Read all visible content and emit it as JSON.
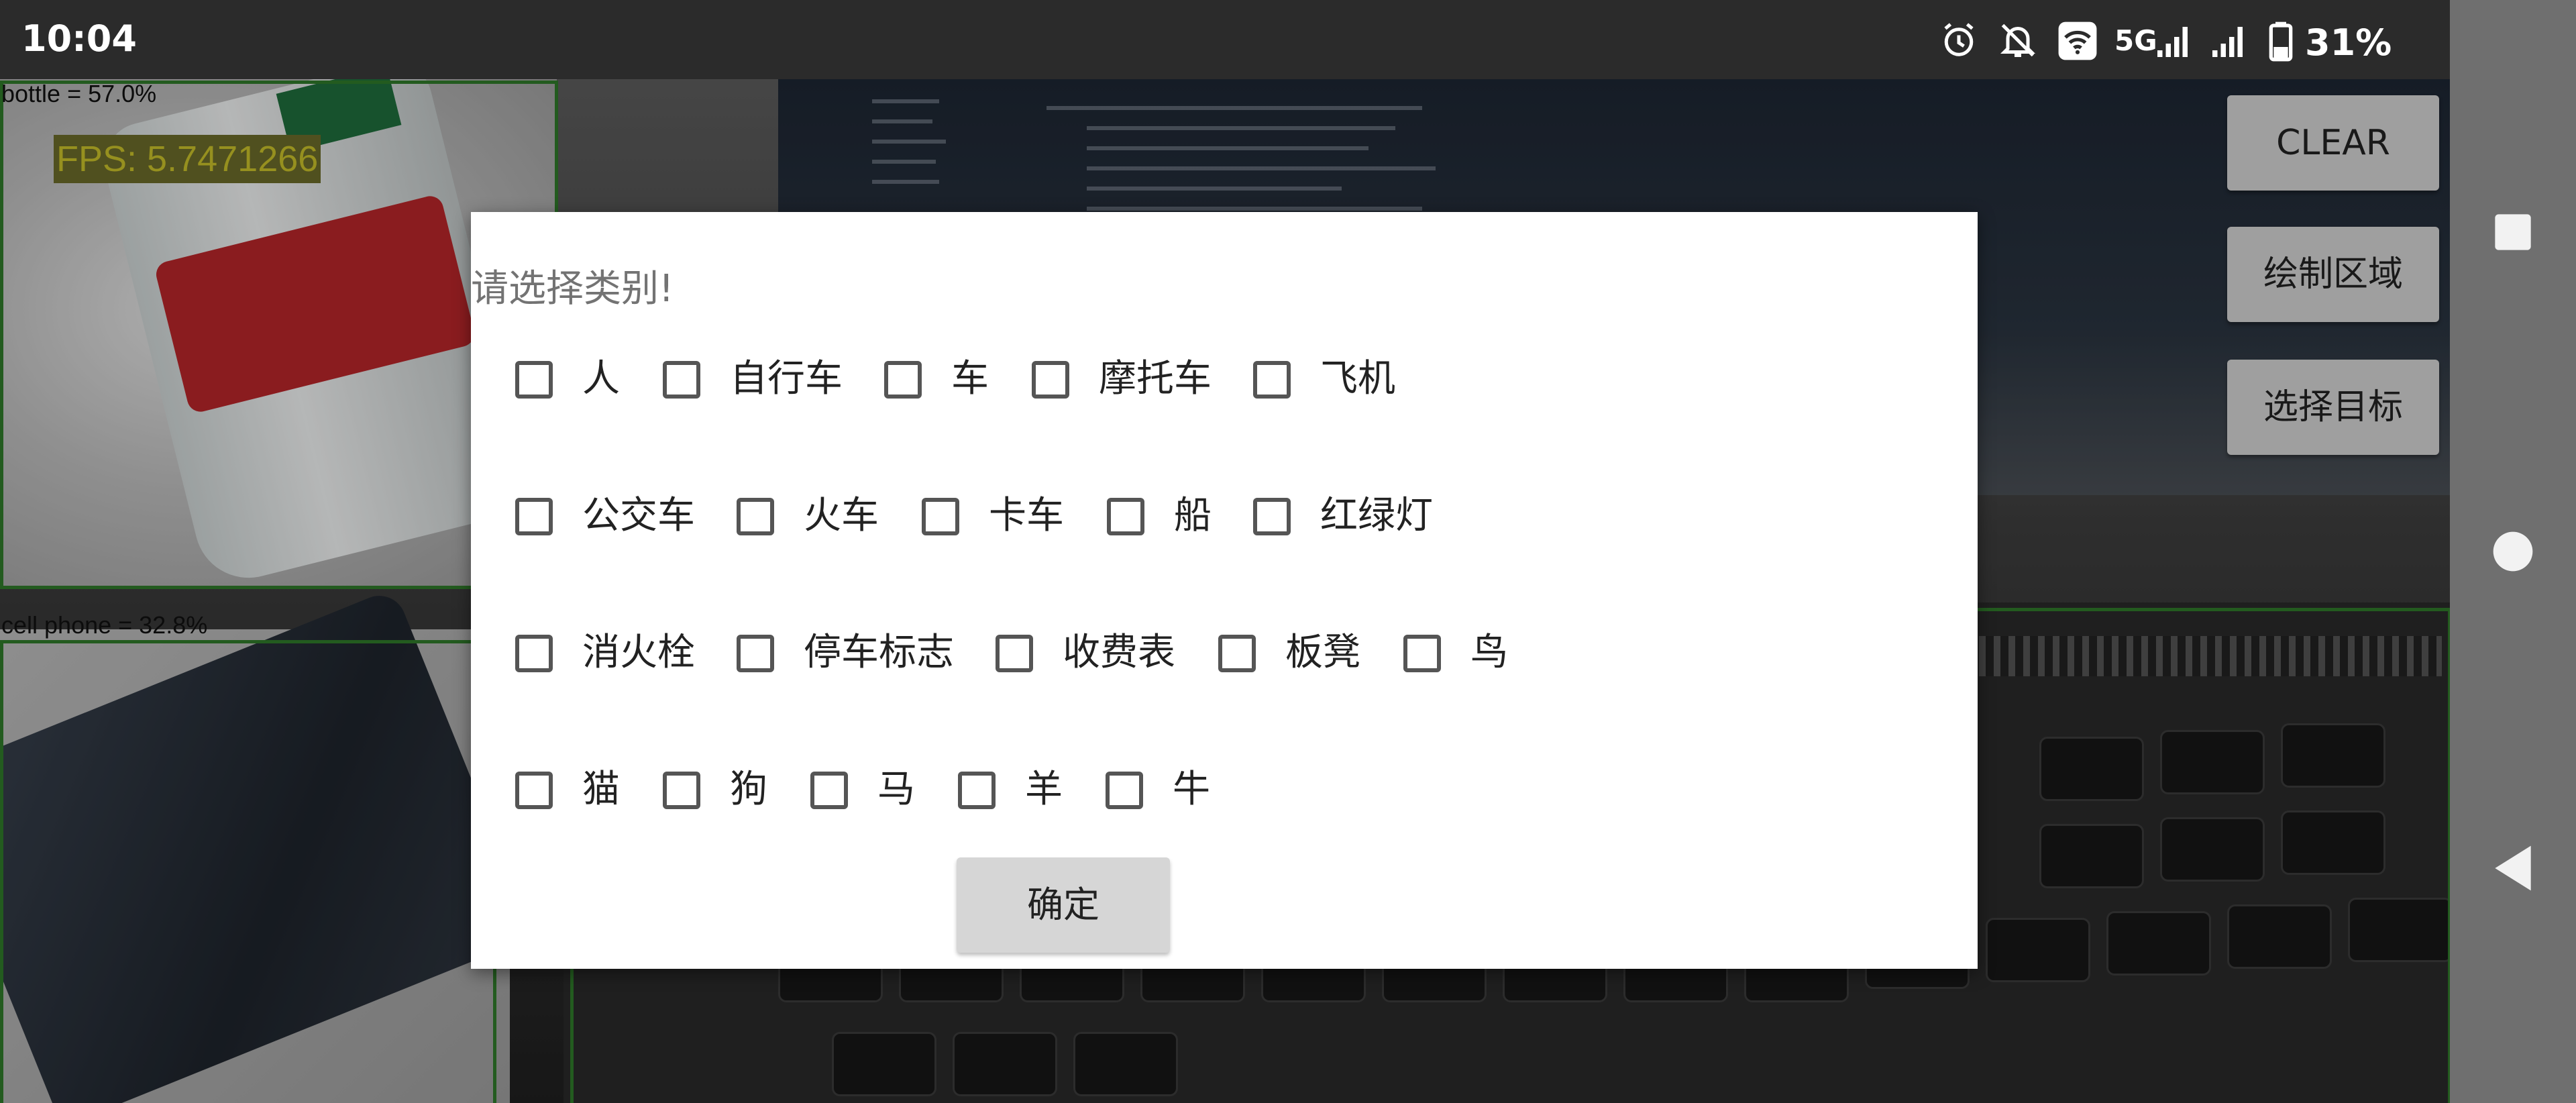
{
  "status_bar": {
    "time": "10:04",
    "network": "5G",
    "battery": "31%",
    "icons": [
      "alarm-icon",
      "bell-off-icon",
      "wifi-icon",
      "signal-icon",
      "signal-icon",
      "battery-icon"
    ]
  },
  "camera": {
    "fps": "FPS: 5.7471266",
    "detections": [
      {
        "label": "bottle = 57.0%"
      },
      {
        "label": "cell phone = 32.8%"
      }
    ]
  },
  "side_buttons": {
    "clear": "CLEAR",
    "draw_region": "绘制区域",
    "select_target": "选择目标"
  },
  "dialog": {
    "title": "请选择类别!",
    "rows": [
      [
        "人",
        "自行车",
        "车",
        "摩托车",
        "飞机"
      ],
      [
        "公交车",
        "火车",
        "卡车",
        "船",
        "红绿灯"
      ],
      [
        "消火栓",
        "停车标志",
        "收费表",
        "板凳",
        "鸟"
      ],
      [
        "猫",
        "狗",
        "马",
        "羊",
        "牛"
      ]
    ],
    "confirm": "确定"
  },
  "nav_bar": {
    "icons": [
      "recents-square-icon",
      "home-circle-icon",
      "back-triangle-icon"
    ]
  },
  "colors": {
    "detection_box": "#2f7a2a",
    "fps_text": "#c9c12a",
    "dialog_bg": "#ffffff",
    "button_bg": "#d4d4d4"
  }
}
